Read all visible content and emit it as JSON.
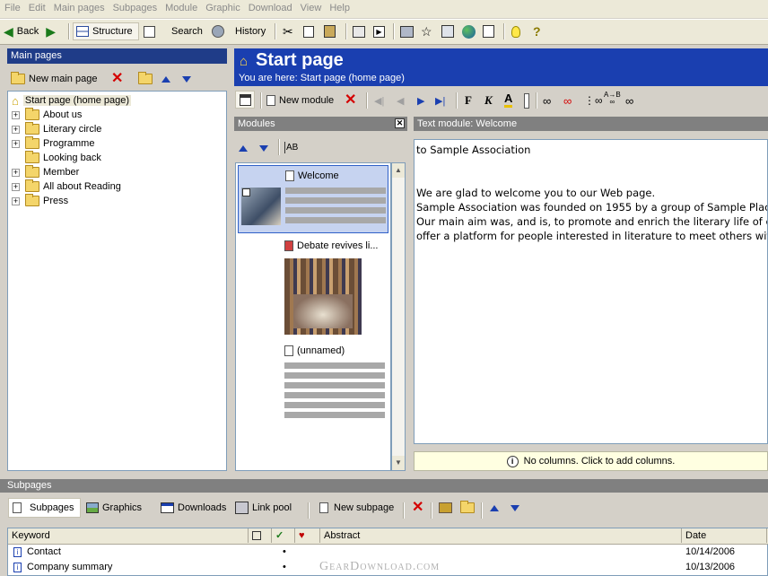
{
  "menu": [
    "File",
    "Edit",
    "Main pages",
    "Subpages",
    "Module",
    "Graphic",
    "Download",
    "View",
    "Help"
  ],
  "toolbar": {
    "back": "Back",
    "structure": "Structure",
    "search": "Search",
    "history": "History"
  },
  "main_pages": {
    "title": "Main pages",
    "new_button": "New main page",
    "root": "Start page (home page)",
    "items": [
      "About us",
      "Literary circle",
      "Programme",
      "Looking back",
      "Member",
      "All about Reading",
      "Press"
    ]
  },
  "page_header": {
    "title": "Start page",
    "breadcrumb": "You are here: Start page (home page)"
  },
  "editor_toolbar": {
    "new_module": "New module",
    "bold": "F",
    "italic": "K",
    "underline_a": "A",
    "ab": "A→B"
  },
  "modules": {
    "title": "Modules",
    "sort_label": "AB",
    "items": [
      {
        "title": "Welcome"
      },
      {
        "title": "Debate revives li..."
      },
      {
        "title": "(unnamed)"
      }
    ]
  },
  "text_module": {
    "title": "Text module: Welcome",
    "lines": [
      "to Sample Association",
      "",
      "We are glad to welcome you to our Web page.",
      "Sample Association was founded on 1955 by a group of Sample Plac",
      "Our main aim was, and is, to promote and enrich the literary life of c",
      "offer a platform for people interested in literature to meet others wit"
    ],
    "columns_hint": "No columns. Click to add columns."
  },
  "subpages": {
    "title": "Subpages",
    "tabs": [
      "Subpages",
      "Graphics",
      "Downloads",
      "Link pool"
    ],
    "new_button": "New subpage",
    "columns": [
      "Keyword",
      "Abstract",
      "Date"
    ],
    "rows": [
      {
        "keyword": "Contact",
        "mark": "•",
        "date": "10/14/2006"
      },
      {
        "keyword": "Company summary",
        "mark": "•",
        "date": "10/13/2006"
      }
    ]
  },
  "watermark": "GearDownload.com",
  "colors": {
    "title_blue": "#1f3c88",
    "header_blue": "#1a3fb0",
    "selection": "#c6d3f0",
    "hint_yellow": "#ffffe1"
  }
}
